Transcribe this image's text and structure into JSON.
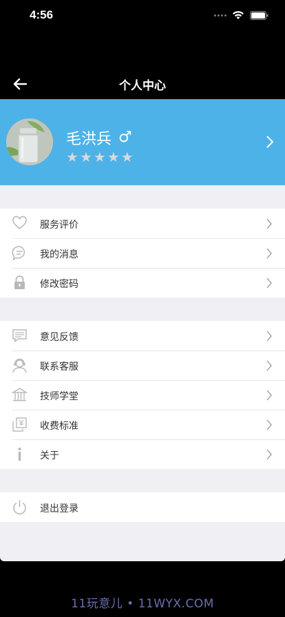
{
  "status_bar": {
    "time": "4:56"
  },
  "nav": {
    "title": "个人中心"
  },
  "profile": {
    "name": "毛洪兵",
    "gender_symbol": "♂",
    "rating": {
      "value": 5,
      "max": 5
    }
  },
  "menu_groups": [
    {
      "items": [
        {
          "icon": "heart-icon",
          "label": "服务评价"
        },
        {
          "icon": "chat-bubble-icon",
          "label": "我的消息"
        },
        {
          "icon": "lock-icon",
          "label": "修改密码"
        }
      ]
    },
    {
      "items": [
        {
          "icon": "feedback-icon",
          "label": "意见反馈"
        },
        {
          "icon": "customer-service-icon",
          "label": "联系客服"
        },
        {
          "icon": "academy-icon",
          "label": "技师学堂"
        },
        {
          "icon": "price-tag-icon",
          "label": "收费标准"
        },
        {
          "icon": "info-icon",
          "label": "关于"
        }
      ]
    },
    {
      "items": [
        {
          "icon": "power-icon",
          "label": "退出登录"
        }
      ]
    }
  ],
  "watermark": "11玩意儿 • 11WYX.COM",
  "colors": {
    "accent": "#4db2e8",
    "background": "#efeff4",
    "icon": "#b8b8b8"
  }
}
